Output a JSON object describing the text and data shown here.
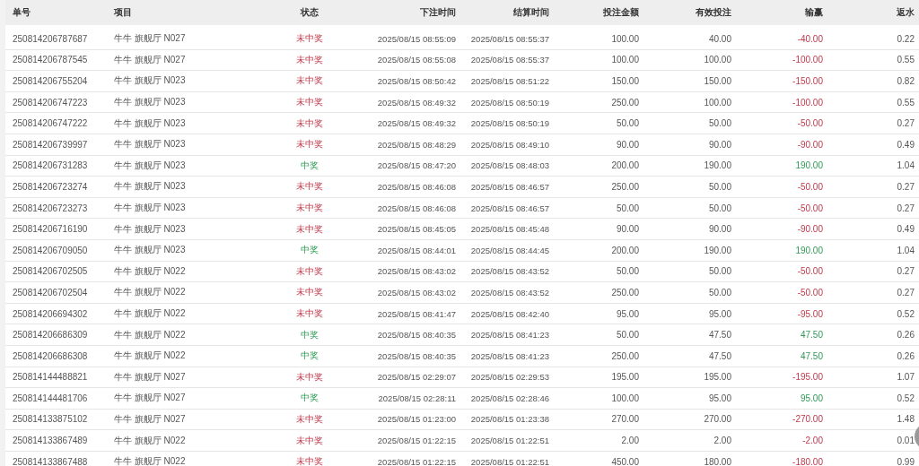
{
  "table": {
    "columns": [
      "单号",
      "项目",
      "状态",
      "下注时间",
      "结算时间",
      "投注金额",
      "有效投注",
      "输赢",
      "返水"
    ],
    "rows": [
      {
        "id": "250814206787687",
        "game": "牛牛 旗舰厅 N027",
        "status": "未中奖",
        "won": false,
        "bet_time": "2025/08/15 08:55:09",
        "settle_time": "2025/08/15 08:55:37",
        "amount": "100.00",
        "valid": "40.00",
        "profit": "-40.00",
        "rebate": "0.22"
      },
      {
        "id": "250814206787545",
        "game": "牛牛 旗舰厅 N027",
        "status": "未中奖",
        "won": false,
        "bet_time": "2025/08/15 08:55:08",
        "settle_time": "2025/08/15 08:55:37",
        "amount": "100.00",
        "valid": "100.00",
        "profit": "-100.00",
        "rebate": "0.55"
      },
      {
        "id": "250814206755204",
        "game": "牛牛 旗舰厅 N023",
        "status": "未中奖",
        "won": false,
        "bet_time": "2025/08/15 08:50:42",
        "settle_time": "2025/08/15 08:51:22",
        "amount": "150.00",
        "valid": "150.00",
        "profit": "-150.00",
        "rebate": "0.82"
      },
      {
        "id": "250814206747223",
        "game": "牛牛 旗舰厅 N023",
        "status": "未中奖",
        "won": false,
        "bet_time": "2025/08/15 08:49:32",
        "settle_time": "2025/08/15 08:50:19",
        "amount": "250.00",
        "valid": "100.00",
        "profit": "-100.00",
        "rebate": "0.55"
      },
      {
        "id": "250814206747222",
        "game": "牛牛 旗舰厅 N023",
        "status": "未中奖",
        "won": false,
        "bet_time": "2025/08/15 08:49:32",
        "settle_time": "2025/08/15 08:50:19",
        "amount": "50.00",
        "valid": "50.00",
        "profit": "-50.00",
        "rebate": "0.27"
      },
      {
        "id": "250814206739997",
        "game": "牛牛 旗舰厅 N023",
        "status": "未中奖",
        "won": false,
        "bet_time": "2025/08/15 08:48:29",
        "settle_time": "2025/08/15 08:49:10",
        "amount": "90.00",
        "valid": "90.00",
        "profit": "-90.00",
        "rebate": "0.49"
      },
      {
        "id": "250814206731283",
        "game": "牛牛 旗舰厅 N023",
        "status": "中奖",
        "won": true,
        "bet_time": "2025/08/15 08:47:20",
        "settle_time": "2025/08/15 08:48:03",
        "amount": "200.00",
        "valid": "190.00",
        "profit": "190.00",
        "rebate": "1.04"
      },
      {
        "id": "250814206723274",
        "game": "牛牛 旗舰厅 N023",
        "status": "未中奖",
        "won": false,
        "bet_time": "2025/08/15 08:46:08",
        "settle_time": "2025/08/15 08:46:57",
        "amount": "250.00",
        "valid": "50.00",
        "profit": "-50.00",
        "rebate": "0.27"
      },
      {
        "id": "250814206723273",
        "game": "牛牛 旗舰厅 N023",
        "status": "未中奖",
        "won": false,
        "bet_time": "2025/08/15 08:46:08",
        "settle_time": "2025/08/15 08:46:57",
        "amount": "50.00",
        "valid": "50.00",
        "profit": "-50.00",
        "rebate": "0.27"
      },
      {
        "id": "250814206716190",
        "game": "牛牛 旗舰厅 N023",
        "status": "未中奖",
        "won": false,
        "bet_time": "2025/08/15 08:45:05",
        "settle_time": "2025/08/15 08:45:48",
        "amount": "90.00",
        "valid": "90.00",
        "profit": "-90.00",
        "rebate": "0.49"
      },
      {
        "id": "250814206709050",
        "game": "牛牛 旗舰厅 N023",
        "status": "中奖",
        "won": true,
        "bet_time": "2025/08/15 08:44:01",
        "settle_time": "2025/08/15 08:44:45",
        "amount": "200.00",
        "valid": "190.00",
        "profit": "190.00",
        "rebate": "1.04"
      },
      {
        "id": "250814206702505",
        "game": "牛牛 旗舰厅 N022",
        "status": "未中奖",
        "won": false,
        "bet_time": "2025/08/15 08:43:02",
        "settle_time": "2025/08/15 08:43:52",
        "amount": "50.00",
        "valid": "50.00",
        "profit": "-50.00",
        "rebate": "0.27"
      },
      {
        "id": "250814206702504",
        "game": "牛牛 旗舰厅 N022",
        "status": "未中奖",
        "won": false,
        "bet_time": "2025/08/15 08:43:02",
        "settle_time": "2025/08/15 08:43:52",
        "amount": "250.00",
        "valid": "50.00",
        "profit": "-50.00",
        "rebate": "0.27"
      },
      {
        "id": "250814206694302",
        "game": "牛牛 旗舰厅 N022",
        "status": "未中奖",
        "won": false,
        "bet_time": "2025/08/15 08:41:47",
        "settle_time": "2025/08/15 08:42:40",
        "amount": "95.00",
        "valid": "95.00",
        "profit": "-95.00",
        "rebate": "0.52"
      },
      {
        "id": "250814206686309",
        "game": "牛牛 旗舰厅 N022",
        "status": "中奖",
        "won": true,
        "bet_time": "2025/08/15 08:40:35",
        "settle_time": "2025/08/15 08:41:23",
        "amount": "50.00",
        "valid": "47.50",
        "profit": "47.50",
        "rebate": "0.26"
      },
      {
        "id": "250814206686308",
        "game": "牛牛 旗舰厅 N022",
        "status": "中奖",
        "won": true,
        "bet_time": "2025/08/15 08:40:35",
        "settle_time": "2025/08/15 08:41:23",
        "amount": "250.00",
        "valid": "47.50",
        "profit": "47.50",
        "rebate": "0.26"
      },
      {
        "id": "250814144488821",
        "game": "牛牛 旗舰厅 N027",
        "status": "未中奖",
        "won": false,
        "bet_time": "2025/08/15 02:29:07",
        "settle_time": "2025/08/15 02:29:53",
        "amount": "195.00",
        "valid": "195.00",
        "profit": "-195.00",
        "rebate": "1.07"
      },
      {
        "id": "250814144481706",
        "game": "牛牛 旗舰厅 N027",
        "status": "中奖",
        "won": true,
        "bet_time": "2025/08/15 02:28:11",
        "settle_time": "2025/08/15 02:28:46",
        "amount": "100.00",
        "valid": "95.00",
        "profit": "95.00",
        "rebate": "0.52"
      },
      {
        "id": "250814133875102",
        "game": "牛牛 旗舰厅 N027",
        "status": "未中奖",
        "won": false,
        "bet_time": "2025/08/15 01:23:00",
        "settle_time": "2025/08/15 01:23:38",
        "amount": "270.00",
        "valid": "270.00",
        "profit": "-270.00",
        "rebate": "1.48"
      },
      {
        "id": "250814133867489",
        "game": "牛牛 旗舰厅 N022",
        "status": "未中奖",
        "won": false,
        "bet_time": "2025/08/15 01:22:15",
        "settle_time": "2025/08/15 01:22:51",
        "amount": "2.00",
        "valid": "2.00",
        "profit": "-2.00",
        "rebate": "0.01"
      },
      {
        "id": "250814133867488",
        "game": "牛牛 旗舰厅 N022",
        "status": "未中奖",
        "won": false,
        "bet_time": "2025/08/15 01:22:15",
        "settle_time": "2025/08/15 01:22:51",
        "amount": "450.00",
        "valid": "180.00",
        "profit": "-180.00",
        "rebate": "0.99"
      }
    ]
  }
}
